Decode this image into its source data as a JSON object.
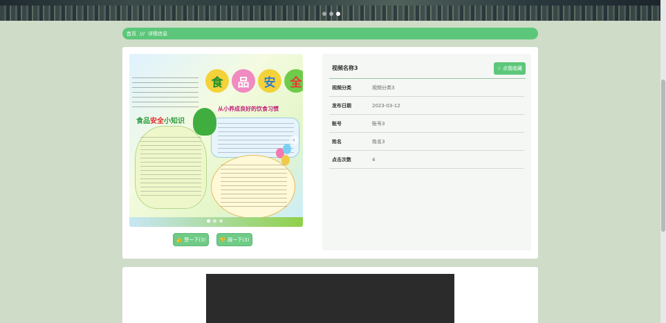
{
  "banner": {
    "slide_count": 3,
    "active_slide": 2
  },
  "breadcrumb": {
    "home": "首页",
    "separator": "///",
    "current": "详情信息"
  },
  "poster": {
    "title_chars": [
      "食",
      "品",
      "安",
      "全"
    ],
    "subtitle": "从小养成良好的饮食习惯",
    "knowledge_prefix": "食品",
    "knowledge_red": "安全",
    "knowledge_suffix": "小知识",
    "carousel_dots": 3,
    "active_dot": 0
  },
  "actions": {
    "like_label": "赞一下(3)",
    "dislike_label": "踩一下(3)"
  },
  "detail": {
    "title": "视频名称3",
    "favorite_label": "点我收藏",
    "fields": [
      {
        "label": "视频分类",
        "value": "视频分类3"
      },
      {
        "label": "发布日期",
        "value": "2023-03-12"
      },
      {
        "label": "账号",
        "value": "账号3"
      },
      {
        "label": "姓名",
        "value": "姓名3"
      },
      {
        "label": "点击次数",
        "value": "4"
      }
    ]
  },
  "colors": {
    "accent": "#5cc77a",
    "page_bg": "#cfdcc8"
  }
}
